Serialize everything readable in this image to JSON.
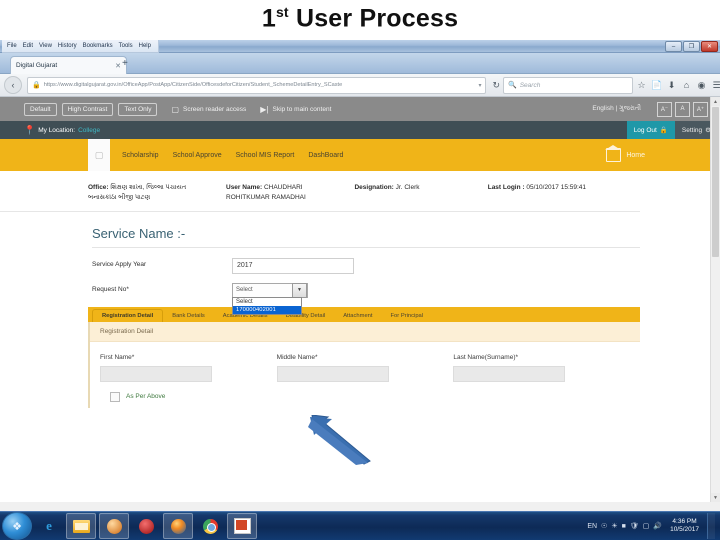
{
  "slide": {
    "title_main": "1",
    "title_sup": "st",
    "title_rest": " User Process"
  },
  "browser": {
    "menu": [
      "File",
      "Edit",
      "View",
      "History",
      "Bookmarks",
      "Tools",
      "Help"
    ],
    "window_buttons": {
      "minimize": "–",
      "maximize": "❐",
      "close": "✕"
    },
    "tab": {
      "label": "Digital Gujarat",
      "close": "✕"
    },
    "new_tab": "+",
    "nav": {
      "back": "‹",
      "lock_icon": "lock-icon",
      "url": "https://www.digitalgujarat.gov.in/OfficeApp/PostApp/CitizenSide/OfficesdeforCitizen/Student_SchemeDetailEntry_SCaste",
      "url_domain": "digitalgujarat.gov.in",
      "url_prefix": "https://www.",
      "url_suffix": "/OfficeApp/PostApp/CitizenSide/OfficesdeforCitizen/Student_SchemeDetailEntry_SCaste",
      "dropdown_caret": "▾",
      "reload": "↻",
      "search_placeholder": "Search",
      "search_icon": "search-icon",
      "toolbar_icons": [
        "bookmark-star-icon",
        "save-page-icon",
        "downloads-icon",
        "home-icon",
        "sync-icon",
        "menu-hamburger-icon"
      ]
    }
  },
  "accessibility": {
    "buttons": [
      "Default",
      "High Contrast",
      "Text Only"
    ],
    "screen_reader": "Screen reader access",
    "skip_link": "Skip to main content",
    "language": "English | ગુજરાતી",
    "font_sizes": [
      "A⁻",
      "A",
      "A⁺"
    ]
  },
  "location_bar": {
    "label": "My Location:",
    "value": "College",
    "pin_icon": "map-pin-icon",
    "logout": "Log Out",
    "logout_icon": "lock-icon",
    "setting": "Setting",
    "setting_icon": "gear-icon"
  },
  "main_nav": {
    "items": [
      "Scholarship",
      "School Approve",
      "School MIS Report",
      "DashBoard"
    ],
    "home": "Home",
    "home_icon": "home-icon"
  },
  "user_info": {
    "office_label": "Office:",
    "office_value": "શિક્ષણ શાખા, જિલ્લા પંચાયત",
    "office_value2": "બનાસકાંઠા બીજી પાટણ",
    "user_label": "User Name:",
    "user_value": "CHAUDHARI",
    "user_value2": "ROHITKUMAR RAMADHAI",
    "designation_label": "Designation:",
    "designation_value": "Jr. Clerk",
    "lastlogin_label": "Last Login :",
    "lastlogin_value": "05/10/2017 15:59:41"
  },
  "service": {
    "heading": "Service Name :-",
    "fields": [
      {
        "label": "Service Apply Year",
        "value": "2017"
      },
      {
        "label": "Request No*",
        "value": "Select"
      }
    ],
    "dropdown_options": [
      "Select",
      "170000402001"
    ],
    "dropdown_selected": "170000402001",
    "dropdown_caret": "▼"
  },
  "tabs": [
    {
      "label": "Registration Detail",
      "active": true
    },
    {
      "label": "Bank Details",
      "active": false
    },
    {
      "label": "Academic Details",
      "active": false
    },
    {
      "label": "Disability Detail",
      "active": false
    },
    {
      "label": "Attachment",
      "active": false
    },
    {
      "label": "For Principal",
      "active": false
    }
  ],
  "panel": {
    "header": "Registration Detail",
    "name_fields": [
      {
        "label": "First Name*",
        "value": ""
      },
      {
        "label": "Middle Name*",
        "value": ""
      },
      {
        "label": "Last Name(Surname)*",
        "value": ""
      }
    ],
    "checkbox_label": "As Per Above"
  },
  "scrollbar": {
    "up": "▲",
    "down": "▼"
  },
  "taskbar": {
    "start_icon": "windows-start-icon",
    "items": [
      "internet-explorer-icon",
      "file-explorer-icon",
      "orange-app-icon",
      "opera-icon",
      "firefox-icon",
      "chrome-icon",
      "powerpoint-icon"
    ],
    "tray_icons": [
      "EN",
      "action-center-icon",
      "network-icon",
      "antivirus-icon",
      "shield-icon",
      "updates-icon",
      "volume-icon"
    ],
    "time": "4:36 PM",
    "date": "10/5/2017"
  },
  "colors": {
    "accent_orange": "#f0b418",
    "dark_slate": "#3f4e55",
    "teal": "#1f98a8",
    "gray_bar": "#8a8a8a",
    "arrow_blue": "#3a6fb0"
  }
}
